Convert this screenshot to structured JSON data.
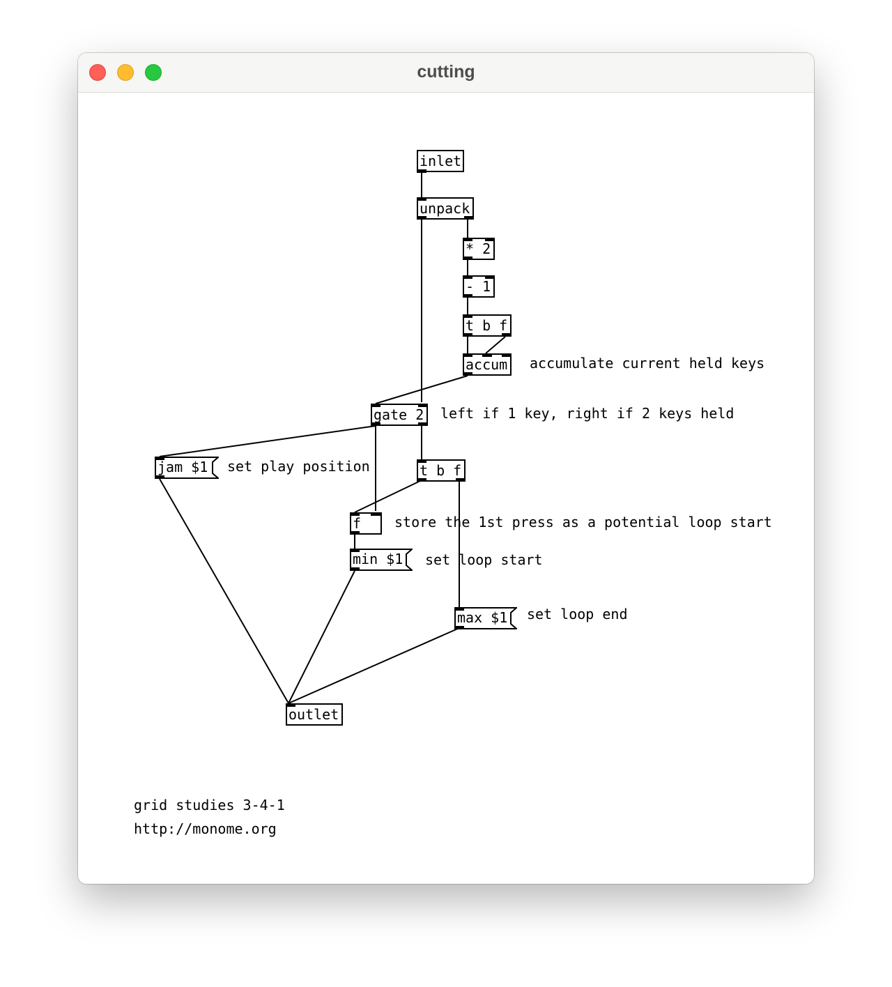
{
  "window": {
    "title": "cutting"
  },
  "objects": {
    "inlet": "inlet",
    "unpack": "unpack",
    "mul": "* 2",
    "sub": "- 1",
    "tbf_top": "t b f",
    "accum": "accum",
    "gate": "gate 2",
    "tbf_bottom": "t b f",
    "float": "f",
    "outlet": "outlet"
  },
  "messages": {
    "jam": "jam $1",
    "min": "min $1",
    "max": "max $1"
  },
  "comments": {
    "accum": "accumulate current held keys",
    "gate": "left if 1 key, right if 2 keys held",
    "jam": "set play position",
    "float": "store the 1st press as a potential loop start",
    "min": "set loop start",
    "max": "set loop end",
    "credit_title": "grid studies 3-4-1",
    "credit_url": "http://monome.org"
  }
}
